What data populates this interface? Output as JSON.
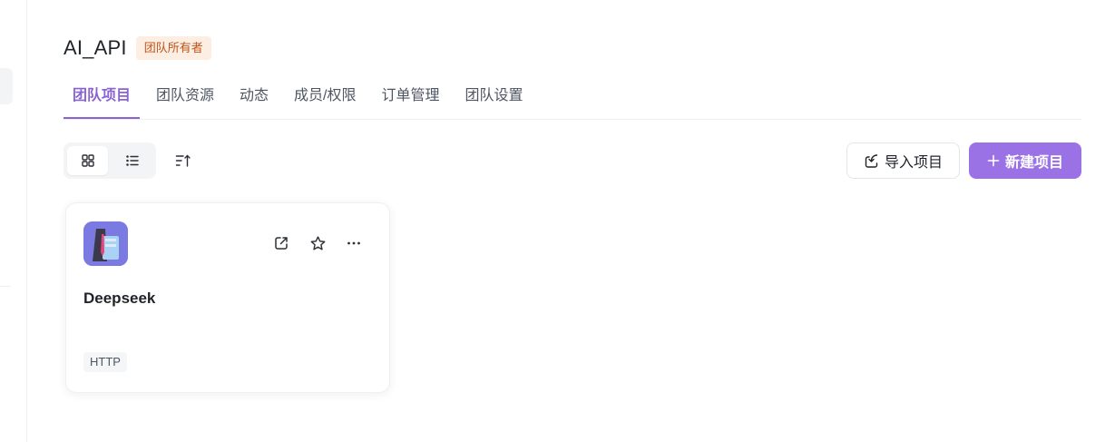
{
  "team": {
    "name": "AI_API",
    "role_badge": "团队所有者"
  },
  "tabs": [
    {
      "label": "团队项目",
      "active": true
    },
    {
      "label": "团队资源",
      "active": false
    },
    {
      "label": "动态",
      "active": false
    },
    {
      "label": "成员/权限",
      "active": false
    },
    {
      "label": "订单管理",
      "active": false
    },
    {
      "label": "团队设置",
      "active": false
    }
  ],
  "toolbar": {
    "view_mode": "grid",
    "import_label": "导入项目",
    "new_label": "新建项目"
  },
  "projects": [
    {
      "name": "Deepseek",
      "protocol": "HTTP",
      "icon": "suit-figure-avatar"
    }
  ],
  "colors": {
    "accent": "#8a63d2",
    "primary_button": "#9b72e6",
    "badge_text": "#c2541a",
    "badge_bg": "#fdeee3"
  }
}
